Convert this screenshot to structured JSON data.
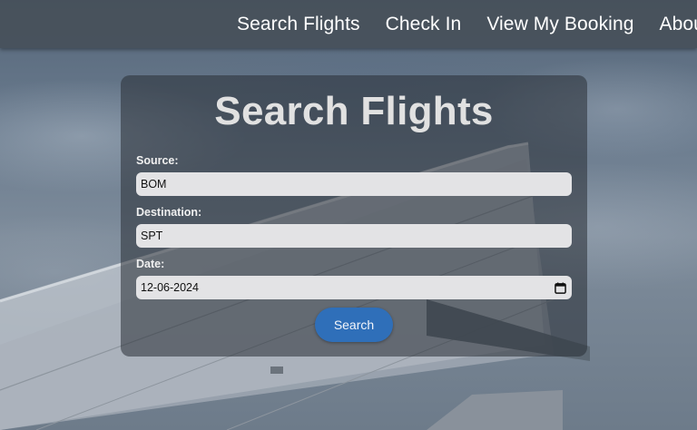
{
  "nav": {
    "items": [
      {
        "label": "Search Flights"
      },
      {
        "label": "Check In"
      },
      {
        "label": "View My Booking"
      },
      {
        "label": "About"
      }
    ]
  },
  "form": {
    "title": "Search Flights",
    "source": {
      "label": "Source:",
      "value": "BOM"
    },
    "destination": {
      "label": "Destination:",
      "value": "SPT"
    },
    "date": {
      "label": "Date:",
      "value": "12-06-2024",
      "icon": "calendar-icon"
    },
    "submit_label": "Search"
  },
  "colors": {
    "navbar": "#464e58",
    "button": "#2f6fb9",
    "input_bg": "#e3e3e5",
    "title": "#e1e1e1"
  }
}
